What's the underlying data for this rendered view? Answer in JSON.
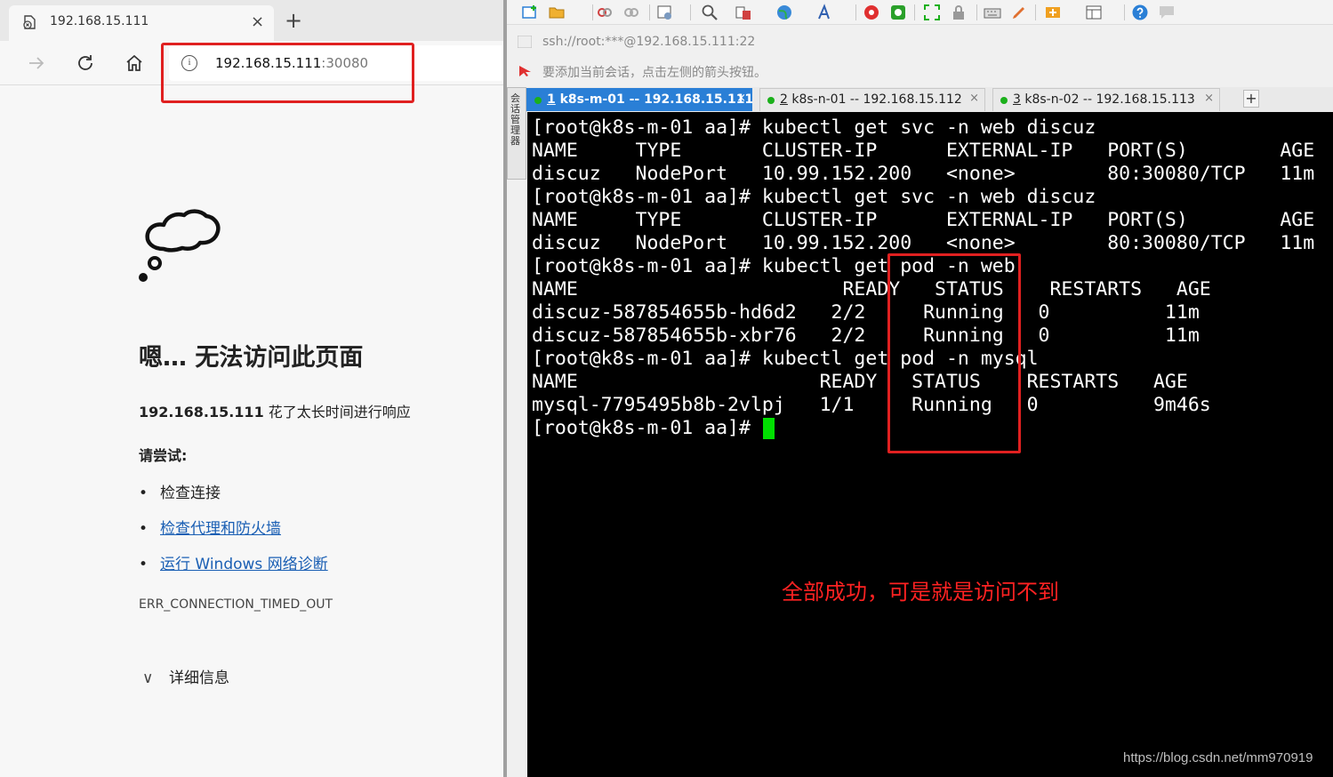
{
  "browser": {
    "tab_title": "192.168.15.111",
    "tab_close": "×",
    "new_tab": "+",
    "address_host": "192.168.15.111",
    "address_port": ":30080",
    "info_glyph": "i",
    "error": {
      "title": "嗯… 无法访问此页面",
      "desc_host": "192.168.15.111",
      "desc_rest": " 花了太长时间进行响应",
      "try_label": "请尝试:",
      "suggestions": [
        "检查连接",
        "检查代理和防火墙",
        "运行 Windows 网络诊断"
      ],
      "bullet": "•",
      "code": "ERR_CONNECTION_TIMED_OUT",
      "details_chevron": "∨",
      "details_label": "详细信息"
    }
  },
  "xshell": {
    "session_address": "ssh://root:***@192.168.15.111:22",
    "hint": "要添加当前会话，点击左侧的箭头按钮。",
    "side_label": "会话管理器",
    "tabs": [
      {
        "num": "1",
        "label": " k8s-m-01 -- 192.168.15.111"
      },
      {
        "num": "2",
        "label": " k8s-n-01 -- 192.168.15.112"
      },
      {
        "num": "3",
        "label": " k8s-n-02 -- 192.168.15.113"
      }
    ],
    "tab_close": "×",
    "add_tab": "+",
    "terminal_lines": [
      "[root@k8s-m-01 aa]# kubectl get svc -n web discuz",
      "NAME     TYPE       CLUSTER-IP      EXTERNAL-IP   PORT(S)        AGE",
      "discuz   NodePort   10.99.152.200   <none>        80:30080/TCP   11m",
      "[root@k8s-m-01 aa]# kubectl get svc -n web discuz",
      "NAME     TYPE       CLUSTER-IP      EXTERNAL-IP   PORT(S)        AGE",
      "discuz   NodePort   10.99.152.200   <none>        80:30080/TCP   11m",
      "[root@k8s-m-01 aa]# kubectl get pod -n web",
      "NAME                       READY   STATUS    RESTARTS   AGE",
      "discuz-587854655b-hd6d2   2/2     Running   0          11m",
      "discuz-587854655b-xbr76   2/2     Running   0          11m",
      "[root@k8s-m-01 aa]# kubectl get pod -n mysql",
      "NAME                     READY   STATUS    RESTARTS   AGE",
      "mysql-7795495b8b-2vlpj   1/1     Running   0          9m46s",
      "[root@k8s-m-01 aa]# "
    ],
    "annotation": "全部成功，可是就是访问不到",
    "watermark": "https://blog.csdn.net/mm970919"
  },
  "colors": {
    "highlight_red": "#e02020",
    "active_tab_blue": "#2a7fd6",
    "cursor_green": "#00e000",
    "link_blue": "#1a5fb4"
  },
  "icons": [
    "error-page-favicon",
    "back-arrow-icon",
    "reload-icon",
    "home-icon",
    "info-icon",
    "sad-cloud-icon",
    "new-session-icon",
    "open-folder-icon",
    "search-icon",
    "globe-icon",
    "help-icon"
  ]
}
